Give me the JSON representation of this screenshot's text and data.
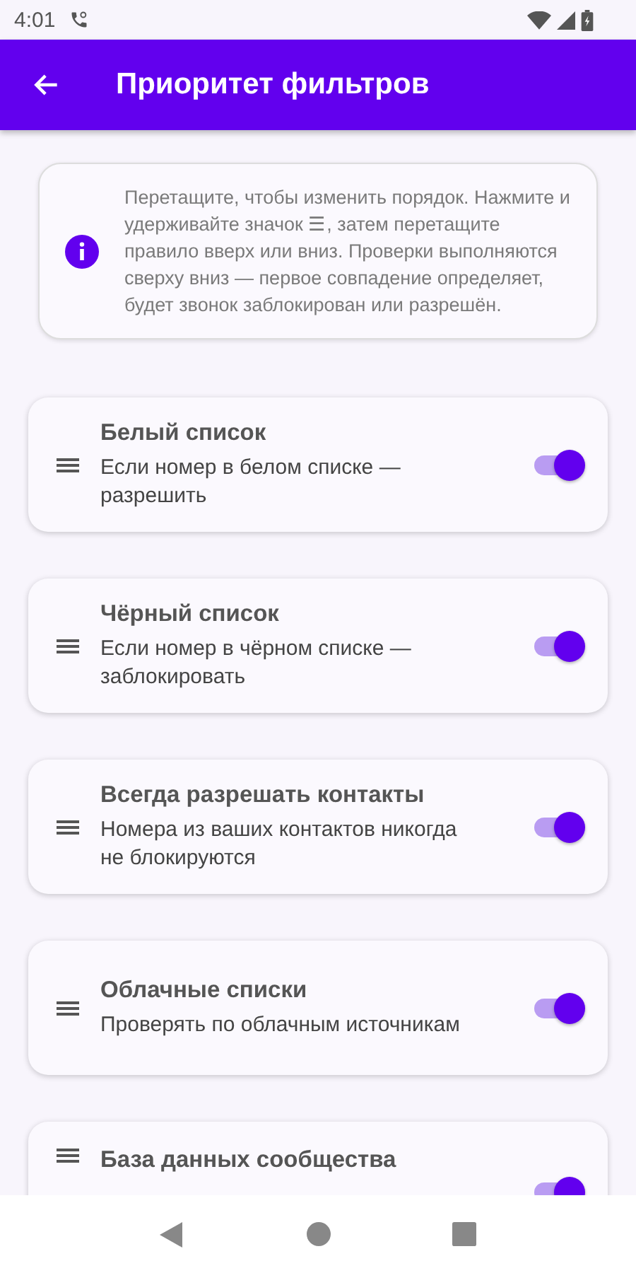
{
  "status_bar": {
    "time": "4:01"
  },
  "app_bar": {
    "title": "Приоритет фильтров"
  },
  "info": {
    "text": "Перетащите, чтобы изменить порядок. Нажмите и удерживайте значок ☰, затем перетащите правило вверх или вниз. Проверки выполняются сверху вниз — первое совпадение определяет, будет звонок заблокирован или разрешён."
  },
  "rules": [
    {
      "title": "Белый список",
      "subtitle": "Если номер в белом списке — разрешить",
      "on": true
    },
    {
      "title": "Чёрный список",
      "subtitle": "Если номер в чёрном списке — заблокировать",
      "on": true
    },
    {
      "title": "Всегда разрешать контакты",
      "subtitle": "Номера из ваших контактов никогда не блокируются",
      "on": true
    },
    {
      "title": "Облачные списки",
      "subtitle": "Проверять по облачным источникам",
      "on": true
    },
    {
      "title": "База данных сообщества",
      "on": true
    }
  ]
}
